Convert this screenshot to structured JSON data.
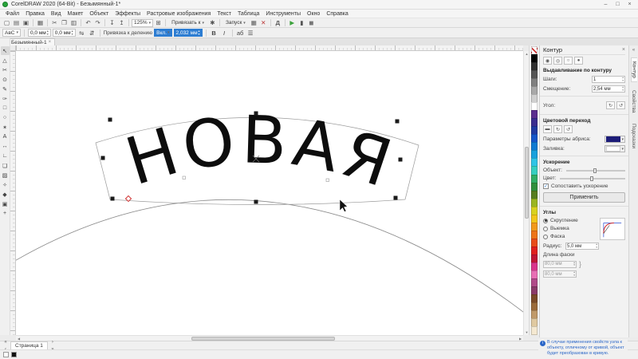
{
  "window": {
    "title": "CorelDRAW 2020 (64-Bit) - Безымянный-1*",
    "minimize": "–",
    "maximize": "□",
    "close": "×"
  },
  "menu": {
    "items": [
      "Файл",
      "Правка",
      "Вид",
      "Макет",
      "Объект",
      "Эффекты",
      "Растровые изображения",
      "Текст",
      "Таблица",
      "Инструменты",
      "Окно",
      "Справка"
    ]
  },
  "toolbar": {
    "icons_left": [
      {
        "name": "new-document-icon",
        "glyph": "▢"
      },
      {
        "name": "open-icon",
        "glyph": "▤"
      },
      {
        "name": "save-icon",
        "glyph": "▣"
      },
      {
        "name": "sep"
      },
      {
        "name": "print-icon",
        "glyph": "▦"
      },
      {
        "name": "sep"
      },
      {
        "name": "cut-icon",
        "glyph": "✂"
      },
      {
        "name": "copy-icon",
        "glyph": "❐"
      },
      {
        "name": "paste-icon",
        "glyph": "▥"
      },
      {
        "name": "sep"
      },
      {
        "name": "undo-icon",
        "glyph": "↶"
      },
      {
        "name": "redo-icon",
        "glyph": "↷"
      },
      {
        "name": "sep"
      },
      {
        "name": "import-icon",
        "glyph": "↧"
      },
      {
        "name": "export-icon",
        "glyph": "↥"
      },
      {
        "name": "sep"
      }
    ],
    "zoom_value": "125%",
    "fullscreen_glyph": "⊞",
    "snap_label": "Привязать к",
    "options_glyph": "✱",
    "launch_label": "Запуск",
    "icons_mid": [
      {
        "name": "show-grid-icon",
        "glyph": "▦"
      },
      {
        "name": "delete-icon",
        "glyph": "✕",
        "color": "#b33"
      }
    ],
    "letter_button": "Д",
    "icons_right": [
      {
        "name": "play-macro-icon",
        "glyph": "▶",
        "color": "#3aa13a"
      },
      {
        "name": "pause-icon",
        "glyph": "▮"
      },
      {
        "name": "record-icon",
        "glyph": "◼",
        "color": "#777"
      }
    ]
  },
  "propbar": {
    "orientation_preview": "АвС",
    "distance_value": "0,0 мм",
    "offset_value": "0,0 мм",
    "mirror_h": "⇋",
    "mirror_v": "⇵",
    "tick_label": "Привязка к делению",
    "tick_state": "Вкл.",
    "tick_interval": "2,032 мм",
    "bold_label": "B",
    "italic_label": "I",
    "text_props_glyph": "аб",
    "align_glyph": "☰"
  },
  "doc_tab": {
    "label": "Безымянный-1",
    "close": "×"
  },
  "toolbox": {
    "tools": [
      {
        "name": "pick-tool",
        "glyph": "↖",
        "active": true
      },
      {
        "name": "shape-tool",
        "glyph": "△"
      },
      {
        "name": "crop-tool",
        "glyph": "✂"
      },
      {
        "name": "zoom-tool",
        "glyph": "⊙"
      },
      {
        "name": "freehand-tool",
        "glyph": "✎"
      },
      {
        "name": "artistic-media-tool",
        "glyph": "✑"
      },
      {
        "name": "rectangle-tool",
        "glyph": "□"
      },
      {
        "name": "ellipse-tool",
        "glyph": "○"
      },
      {
        "name": "polygon-tool",
        "glyph": "✶"
      },
      {
        "name": "text-tool",
        "glyph": "А"
      },
      {
        "name": "dimension-tool",
        "glyph": "↔"
      },
      {
        "name": "connector-tool",
        "glyph": "∟"
      },
      {
        "name": "shadow-tool",
        "glyph": "❏"
      },
      {
        "name": "transparency-tool",
        "glyph": "▨"
      },
      {
        "name": "eyedropper-tool",
        "glyph": "✧"
      },
      {
        "name": "interactive-fill-tool",
        "glyph": "◆"
      },
      {
        "name": "smart-fill-tool",
        "glyph": "▣"
      },
      {
        "name": "add-tool-icon",
        "glyph": "+"
      }
    ]
  },
  "canvas": {
    "artistic_text": "НОВАЯ"
  },
  "palette": {
    "colors": [
      "none",
      "#000000",
      "#2e2e2e",
      "#555555",
      "#7f7f7f",
      "#a8a8a8",
      "#d0d0d0",
      "#ffffff",
      "#5b2d8e",
      "#3a2d8e",
      "#1f3aa0",
      "#1455c8",
      "#0e7ad2",
      "#18a0dc",
      "#2fc4e6",
      "#35cfc0",
      "#2fae66",
      "#2e8f3c",
      "#577d1e",
      "#9ab520",
      "#d9d21f",
      "#f2c71b",
      "#f29a1b",
      "#ed7418",
      "#e84b1a",
      "#e01f1f",
      "#c01535",
      "#d9358c",
      "#e86fb4",
      "#b04a88",
      "#8a3a68",
      "#7a4a28",
      "#9a6a3a",
      "#c09a6a",
      "#e0c9a0",
      "#f5e9d2"
    ]
  },
  "scroll": {
    "up": "▲",
    "down": "▼",
    "left": "◀",
    "right": "▶"
  },
  "docker": {
    "contour": {
      "title": "Контур",
      "close": "×",
      "preset_icons": [
        {
          "name": "contour-to-center-icon",
          "glyph": "◉"
        },
        {
          "name": "contour-inside-icon",
          "glyph": "◎"
        },
        {
          "name": "contour-outside-icon",
          "glyph": "○"
        },
        {
          "name": "contour-none-icon",
          "glyph": "●"
        }
      ],
      "section_offset": "Выдавливание по контуру",
      "steps_label": "Шаги:",
      "steps_value": "1",
      "offset_label": "Смещение:",
      "offset_value": "2,54 мм",
      "angle_label": "Угол:",
      "angle_icons": [
        {
          "name": "angle-cw-icon",
          "glyph": "↻"
        },
        {
          "name": "angle-ccw-icon",
          "glyph": "↺"
        }
      ],
      "color_section": "Цветовой переход",
      "blend_icons": [
        {
          "name": "linear-blend-icon",
          "glyph": "▬"
        },
        {
          "name": "clockwise-blend-icon",
          "glyph": "↻"
        },
        {
          "name": "counterclockwise-blend-icon",
          "glyph": "↺"
        }
      ],
      "outline_label": "Параметры абриса:",
      "outline_color": "#1c1c78",
      "fill_label": "Заливка:",
      "fill_color": "#ffffff",
      "accel_section": "Ускорение",
      "object_label": "Объект:",
      "color_label": "Цвет:",
      "link_accel_label": "Сопоставить ускорение",
      "link_accel_check": "✓",
      "apply_label": "Применить"
    },
    "corners": {
      "title": "Углы",
      "options": [
        {
          "label": "Скругление",
          "selected": true
        },
        {
          "label": "Выемка",
          "selected": false
        },
        {
          "label": "Фаска",
          "selected": false
        }
      ],
      "radius_label": "Радиус:",
      "radius_value": "5,0 мм",
      "chamfer_label": "Длина фаски",
      "length1": "80,0 мм",
      "length2": "80,0 мм"
    }
  },
  "right_tabs": [
    "Контур",
    "Свойства",
    "Подсказки"
  ],
  "pagebar": {
    "nav": [
      "«",
      "‹",
      "›",
      "»"
    ],
    "page_label": "Страница 1"
  },
  "statusbar": {
    "info": "В случае применения свойств узла к объекту, отличному от кривой, объект будет преобразован в кривую."
  }
}
